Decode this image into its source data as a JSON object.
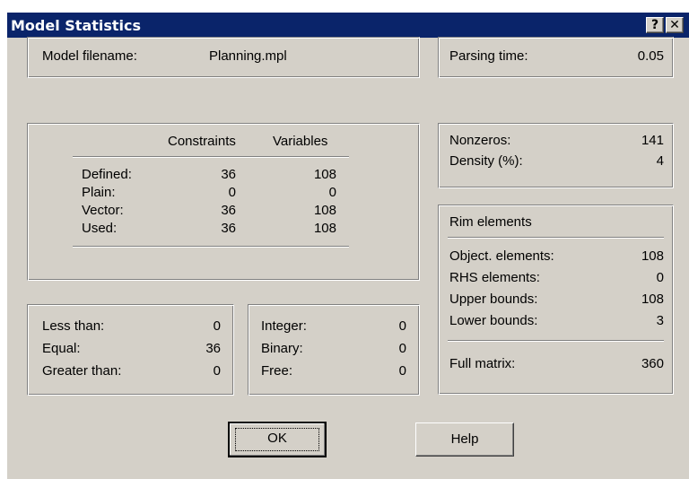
{
  "window": {
    "title": "Model Statistics",
    "help_glyph": "?",
    "close_glyph": "✕"
  },
  "model": {
    "label": "Model filename:",
    "value": "Planning.mpl"
  },
  "parsing": {
    "label": "Parsing time:",
    "value": "0.05"
  },
  "counts": {
    "headers": {
      "constraints": "Constraints",
      "variables": "Variables"
    },
    "rows": [
      {
        "label": "Defined:",
        "constraints": "36",
        "variables": "108"
      },
      {
        "label": "Plain:",
        "constraints": "0",
        "variables": "0"
      },
      {
        "label": "Vector:",
        "constraints": "36",
        "variables": "108"
      },
      {
        "label": "Used:",
        "constraints": "36",
        "variables": "108"
      }
    ]
  },
  "nonzeros": {
    "rows": [
      {
        "label": "Nonzeros:",
        "value": "141"
      },
      {
        "label": "Density (%):",
        "value": "4"
      }
    ]
  },
  "rim": {
    "title": "Rim elements",
    "rows": [
      {
        "label": "Object. elements:",
        "value": "108"
      },
      {
        "label": "RHS elements:",
        "value": "0"
      },
      {
        "label": "Upper bounds:",
        "value": "108"
      },
      {
        "label": "Lower bounds:",
        "value": "3"
      }
    ],
    "full": {
      "label": "Full matrix:",
      "value": "360"
    }
  },
  "constraint_types": {
    "rows": [
      {
        "label": "Less than:",
        "value": "0"
      },
      {
        "label": "Equal:",
        "value": "36"
      },
      {
        "label": "Greater than:",
        "value": "0"
      }
    ]
  },
  "variable_types": {
    "rows": [
      {
        "label": "Integer:",
        "value": "0"
      },
      {
        "label": "Binary:",
        "value": "0"
      },
      {
        "label": "Free:",
        "value": "0"
      }
    ]
  },
  "buttons": {
    "ok": "OK",
    "help": "Help"
  }
}
